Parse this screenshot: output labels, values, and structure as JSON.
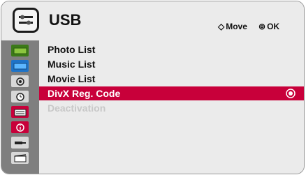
{
  "header": {
    "title": "USB",
    "move_hint": "Move",
    "ok_hint": "OK",
    "move_glyph": "◇",
    "ok_glyph": "⊚"
  },
  "sidebar": {
    "items": [
      {
        "name": "picture-icon"
      },
      {
        "name": "image-icon"
      },
      {
        "name": "sound-icon"
      },
      {
        "name": "time-icon"
      },
      {
        "name": "usb-icon",
        "selected": true
      },
      {
        "name": "info-icon"
      },
      {
        "name": "input-icon"
      },
      {
        "name": "movie-icon"
      }
    ]
  },
  "menu": {
    "items": [
      {
        "label": "Photo List",
        "state": "normal"
      },
      {
        "label": "Music List",
        "state": "normal"
      },
      {
        "label": "Movie List",
        "state": "normal"
      },
      {
        "label": "DivX Reg. Code",
        "state": "selected"
      },
      {
        "label": "Deactivation",
        "state": "disabled"
      }
    ]
  },
  "colors": {
    "accent": "#c8003a",
    "sidebar": "#7f7f7f",
    "background": "#ebebeb"
  }
}
